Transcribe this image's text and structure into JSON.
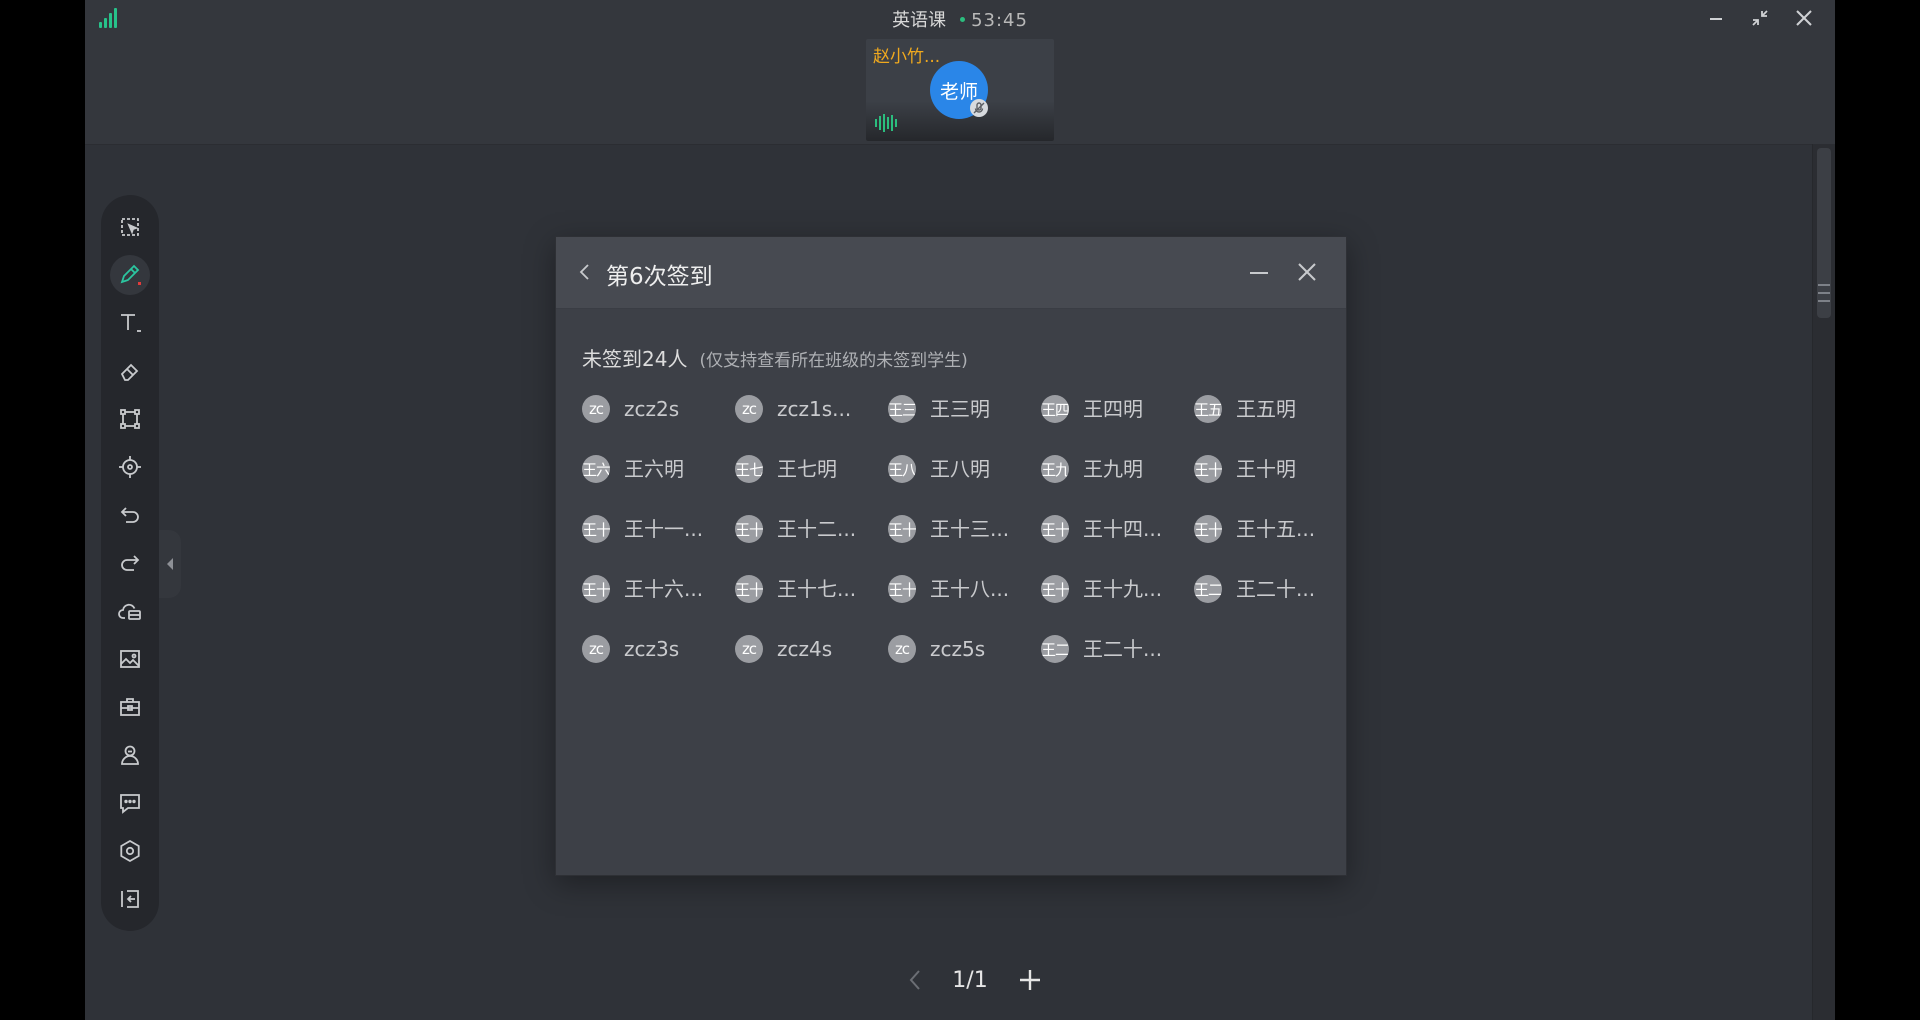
{
  "app": {
    "title": "英语课",
    "timer": "53:45",
    "accent_color": "#2bbd7e"
  },
  "window_controls": [
    "minimize-icon",
    "restore-icon",
    "close-icon"
  ],
  "video": {
    "name": "赵小竹...",
    "avatar_text": "老师",
    "name_color": "#f0a91e",
    "avatar_color": "#2a86e8"
  },
  "toolbar": [
    "select-icon",
    "pen-icon",
    "text-icon",
    "eraser-icon",
    "shape-icon",
    "laser-pointer-icon",
    "undo-icon",
    "redo-icon",
    "cloud-disk-icon",
    "image-icon",
    "toolbox-icon",
    "user-icon",
    "chat-icon",
    "settings-icon",
    "exit-icon"
  ],
  "dialog": {
    "title": "第6次签到",
    "summary": "未签到24人",
    "note": "(仅支持查看所在班级的未签到学生)",
    "students": [
      {
        "avatar": "zc",
        "name": "zcz2s"
      },
      {
        "avatar": "zc",
        "name": "zcz1s..."
      },
      {
        "avatar": "王三",
        "name": "王三明"
      },
      {
        "avatar": "王四",
        "name": "王四明"
      },
      {
        "avatar": "王五",
        "name": "王五明"
      },
      {
        "avatar": "王六",
        "name": "王六明"
      },
      {
        "avatar": "王七",
        "name": "王七明"
      },
      {
        "avatar": "王八",
        "name": "王八明"
      },
      {
        "avatar": "王九",
        "name": "王九明"
      },
      {
        "avatar": "王十",
        "name": "王十明"
      },
      {
        "avatar": "王十",
        "name": "王十一..."
      },
      {
        "avatar": "王十",
        "name": "王十二..."
      },
      {
        "avatar": "王十",
        "name": "王十三..."
      },
      {
        "avatar": "王十",
        "name": "王十四..."
      },
      {
        "avatar": "王十",
        "name": "王十五..."
      },
      {
        "avatar": "王十",
        "name": "王十六..."
      },
      {
        "avatar": "王十",
        "name": "王十七..."
      },
      {
        "avatar": "王十",
        "name": "王十八..."
      },
      {
        "avatar": "王十",
        "name": "王十九..."
      },
      {
        "avatar": "王二",
        "name": "王二十..."
      },
      {
        "avatar": "zc",
        "name": "zcz3s"
      },
      {
        "avatar": "zc",
        "name": "zcz4s"
      },
      {
        "avatar": "zc",
        "name": "zcz5s"
      },
      {
        "avatar": "王二",
        "name": "王二十..."
      }
    ]
  },
  "pager": {
    "text": "1/1"
  }
}
